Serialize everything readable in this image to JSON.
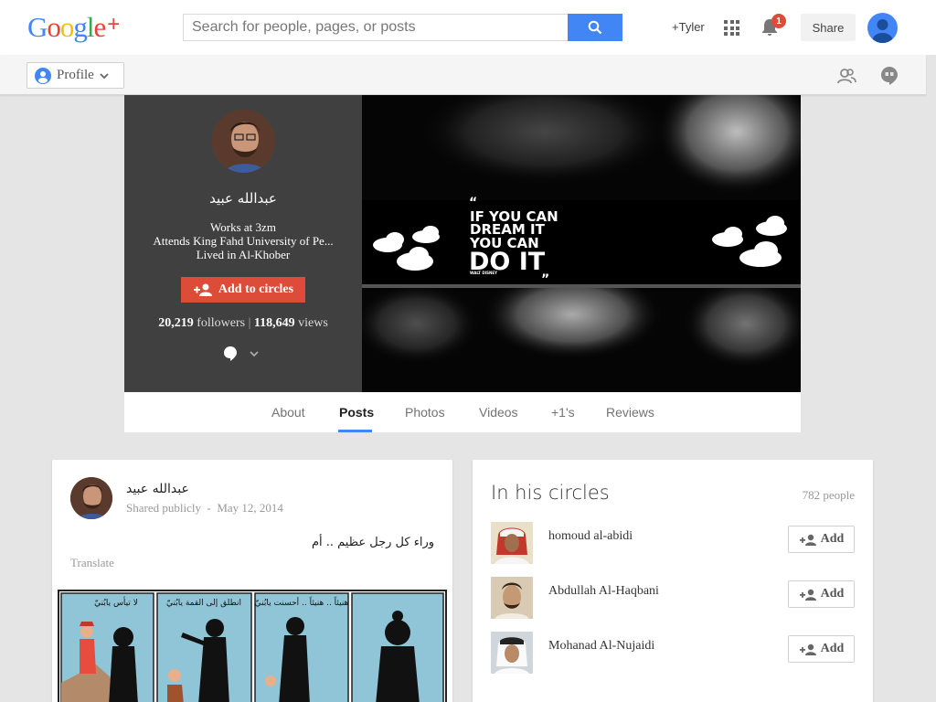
{
  "header": {
    "logo_letters": [
      "G",
      "o",
      "o",
      "g",
      "l",
      "e"
    ],
    "logo_colors": [
      "#4285f4",
      "#ea4335",
      "#fbbc05",
      "#4285f4",
      "#34a853",
      "#ea4335"
    ],
    "logo_plus": "+",
    "search_placeholder": "Search for people, pages, or posts",
    "user_link": "+Tyler",
    "notification_count": "1",
    "share_label": "Share"
  },
  "subbar": {
    "profile_label": "Profile"
  },
  "profile": {
    "name": "عبدالله عبيد",
    "info_lines": [
      "Works at 3zm",
      "Attends King Fahd University of Pe...",
      "Lived in Al-Khober"
    ],
    "add_circles_label": "Add to circles",
    "followers_count": "20,219",
    "followers_label": "followers",
    "views_count": "118,649",
    "views_label": "views"
  },
  "cover": {
    "quote_lines": [
      "IF YOU CAN",
      "DREAM IT",
      "YOU CAN",
      "DO IT"
    ],
    "quote_author": "WALT DISNEY"
  },
  "tabs": [
    "About",
    "Posts",
    "Photos",
    "Videos",
    "+1's",
    "Reviews"
  ],
  "active_tab": "Posts",
  "post": {
    "author": "عبدالله عبيد",
    "visibility": "Shared publicly",
    "separator": "-",
    "date": "May 12, 2014",
    "text": "وراء كل رجل عظيم .. أم",
    "translate_label": "Translate",
    "comic_captions": [
      "لا تيأس يابُنيّ",
      "انطلق إلى القمة يابُنيّ",
      "هنيئاً .. هنيئاً .. أحسنت يابُنيّ"
    ]
  },
  "circles": {
    "title": "In his circles",
    "count": "782 people",
    "add_label": "Add",
    "people": [
      {
        "name": "homoud al-abidi"
      },
      {
        "name": "Abdullah Al-Haqbani"
      },
      {
        "name": "Mohanad Al-Nujaidi"
      }
    ]
  }
}
